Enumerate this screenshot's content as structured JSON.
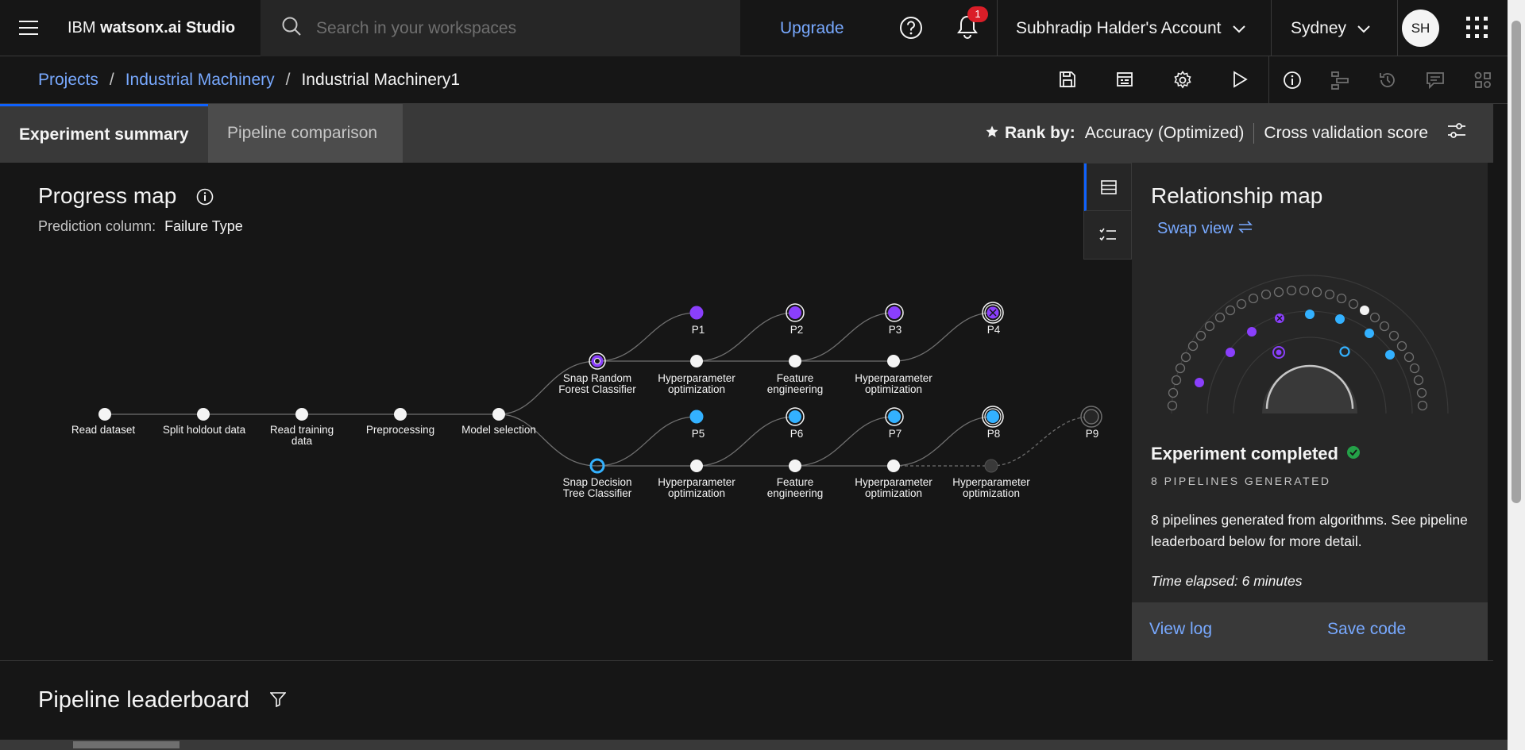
{
  "header": {
    "brand_prefix": "IBM",
    "brand_product": "watsonx.ai Studio",
    "search_placeholder": "Search in your workspaces",
    "upgrade_label": "Upgrade",
    "notification_count": "1",
    "account_label": "Subhradip Halder's Account",
    "region_label": "Sydney",
    "avatar_initials": "SH"
  },
  "breadcrumb": {
    "items": [
      "Projects",
      "Industrial Machinery"
    ],
    "current": "Industrial Machinery1",
    "separator": "/"
  },
  "toolbar": {
    "icons": [
      "save-icon",
      "notebook-icon",
      "settings-icon",
      "run-icon",
      "info-icon",
      "lineage-icon",
      "history-icon",
      "comments-icon",
      "assets-icon"
    ]
  },
  "tabs": {
    "experiment_summary": "Experiment summary",
    "pipeline_comparison": "Pipeline comparison"
  },
  "rank": {
    "label": "Rank by:",
    "metric": "Accuracy (Optimized)",
    "score": "Cross validation score"
  },
  "progress_map": {
    "title": "Progress map",
    "prediction_label": "Prediction column:",
    "prediction_value": "Failure Type",
    "steps": [
      "Read dataset",
      "Split holdout data",
      "Read training data",
      "Preprocessing",
      "Model selection"
    ],
    "algorithms": [
      "Snap Random Forest Classifier",
      "Snap Decision Tree Classifier"
    ],
    "stage_labels": [
      "Hyperparameter optimization",
      "Feature engineering",
      "Hyperparameter optimization",
      "Hyperparameter optimization"
    ],
    "pipelines": [
      "P1",
      "P2",
      "P3",
      "P4",
      "P5",
      "P6",
      "P7",
      "P8",
      "P9"
    ],
    "colors": {
      "random_forest": "#8a3ffc",
      "decision_tree": "#33b1ff",
      "node": "#f4f4f4",
      "pending": "#393939"
    }
  },
  "relationship_map": {
    "title": "Relationship map",
    "swap_label": "Swap view",
    "status": "Experiment completed",
    "pipelines_generated": "8 PIPELINES GENERATED",
    "description": "8 pipelines generated from algorithms. See pipeline leaderboard below for more detail.",
    "time_elapsed": "Time elapsed: 6 minutes",
    "view_log": "View log",
    "save_code": "Save code"
  },
  "leaderboard": {
    "title": "Pipeline leaderboard"
  }
}
